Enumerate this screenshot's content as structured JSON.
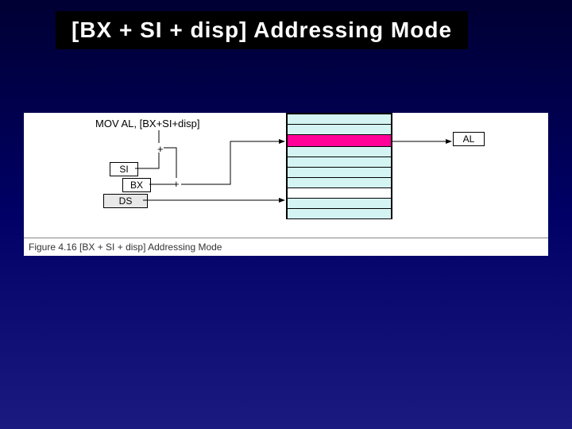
{
  "title": "[BX + SI + disp] Addressing Mode",
  "figure": {
    "instruction": "MOV  AL, [BX+SI+disp]",
    "registers": {
      "si": "SI",
      "bx": "BX",
      "ds": "DS",
      "al": "AL"
    },
    "plus1": "+",
    "plus2": "+",
    "caption": "Figure 4.16 [BX + SI + disp] Addressing Mode"
  },
  "colors": {
    "background_top": "#000033",
    "background_bottom": "#1a1a80",
    "title_bg": "#000000",
    "title_fg": "#ffffff",
    "memory_cell": "#d4f4f4",
    "memory_highlight": "#ff0099",
    "ds_bg": "#e8e8e8"
  }
}
